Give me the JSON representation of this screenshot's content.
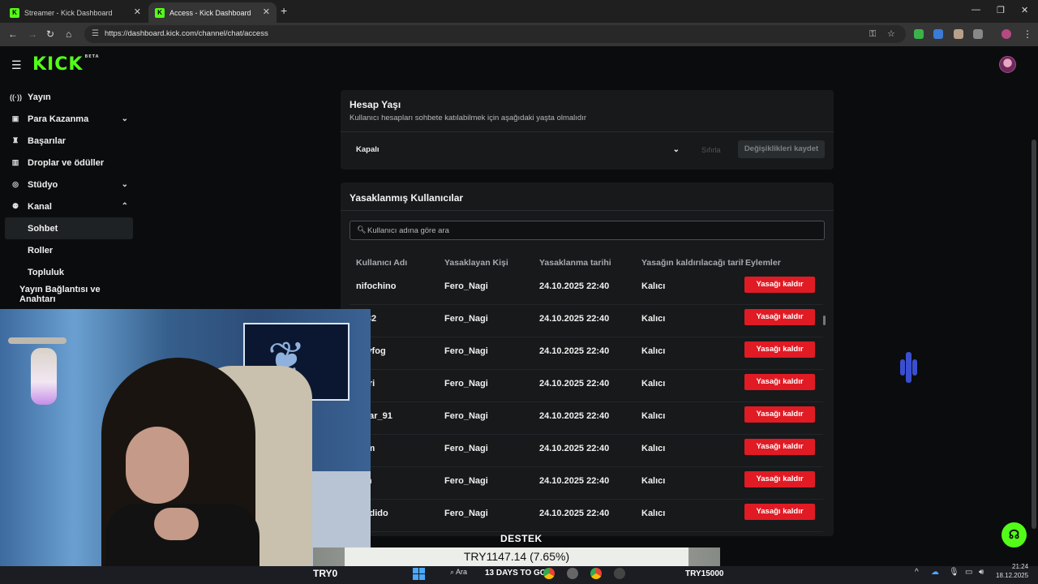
{
  "browser": {
    "tabs": [
      {
        "label": "Streamer - Kick Dashboard",
        "active": false
      },
      {
        "label": "Access - Kick Dashboard",
        "active": true
      }
    ],
    "url": "https://dashboard.kick.com/channel/chat/access",
    "overlay_handle": "Fero_Nagi"
  },
  "brand": {
    "logo": "KICK",
    "beta": "BETA",
    "accent": "#53fc18"
  },
  "sidebar": {
    "items": [
      {
        "label": "Yayın",
        "icon": "broadcast-icon"
      },
      {
        "label": "Para Kazanma",
        "icon": "money-icon",
        "expandable": true
      },
      {
        "label": "Başarılar",
        "icon": "trophy-icon"
      },
      {
        "label": "Droplar ve ödüller",
        "icon": "gift-icon"
      },
      {
        "label": "Stüdyo",
        "icon": "studio-icon",
        "expandable": true
      },
      {
        "label": "Kanal",
        "icon": "channel-icon",
        "expanded": true
      }
    ],
    "subitems": [
      "Sohbet",
      "Roller",
      "Topluluk"
    ],
    "extra": "Yayın Bağlantısı ve Anahtarı"
  },
  "account_age": {
    "title": "Hesap Yaşı",
    "description": "Kullanıcı hesapları sohbete katılabilmek için aşağıdaki yaşta olmalıdır",
    "selected": "Kapalı",
    "reset_label": "Sıfırla",
    "save_label": "Değişiklikleri kaydet"
  },
  "banned": {
    "title": "Yasaklanmış Kullanıcılar",
    "search_placeholder": "Kullanıcı adına göre ara",
    "columns": [
      "Kullanıcı Adı",
      "Yasaklayan Kişi",
      "Yasaklanma tarihi",
      "Yasağın kaldırılacağı tarih",
      "Eylemler"
    ],
    "rows": [
      {
        "user": "nifochino",
        "by": "Fero_Nagi",
        "date": "24.10.2025 22:40",
        "until": "Kalıcı",
        "action": "Yasağı kaldır"
      },
      {
        "user": "en82",
        "by": "Fero_Nagi",
        "date": "24.10.2025 22:40",
        "until": "Kalıcı",
        "action": "Yasağı kaldır"
      },
      {
        "user": "odyfog",
        "by": "Fero_Nagi",
        "date": "24.10.2025 22:40",
        "until": "Kalıcı",
        "action": "Yasağı kaldır"
      },
      {
        "user": "astri",
        "by": "Fero_Nagi",
        "date": "24.10.2025 22:40",
        "until": "Kalıcı",
        "action": "Yasağı kaldır"
      },
      {
        "user": "_War_91",
        "by": "Fero_Nagi",
        "date": "24.10.2025 22:40",
        "until": "Kalıcı",
        "action": "Yasağı kaldır"
      },
      {
        "user": "airm",
        "by": "Fero_Nagi",
        "date": "24.10.2025 22:40",
        "until": "Kalıcı",
        "action": "Yasağı kaldır"
      },
      {
        "user": "gan",
        "by": "Fero_Nagi",
        "date": "24.10.2025 22:40",
        "until": "Kalıcı",
        "action": "Yasağı kaldır"
      },
      {
        "user": "omdido",
        "by": "Fero_Nagi",
        "date": "24.10.2025 22:40",
        "until": "Kalıcı",
        "action": "Yasağı kaldır"
      }
    ]
  },
  "stream_overlay": {
    "label": "DESTEK",
    "ticker": "TRY1147.14 (7.65%)",
    "left": "TRY0",
    "right": "TRY15000",
    "countdown": "13 DAYS TO GO"
  },
  "taskbar": {
    "search": "Ara",
    "time": "21:24",
    "date": "18.12.2025"
  }
}
